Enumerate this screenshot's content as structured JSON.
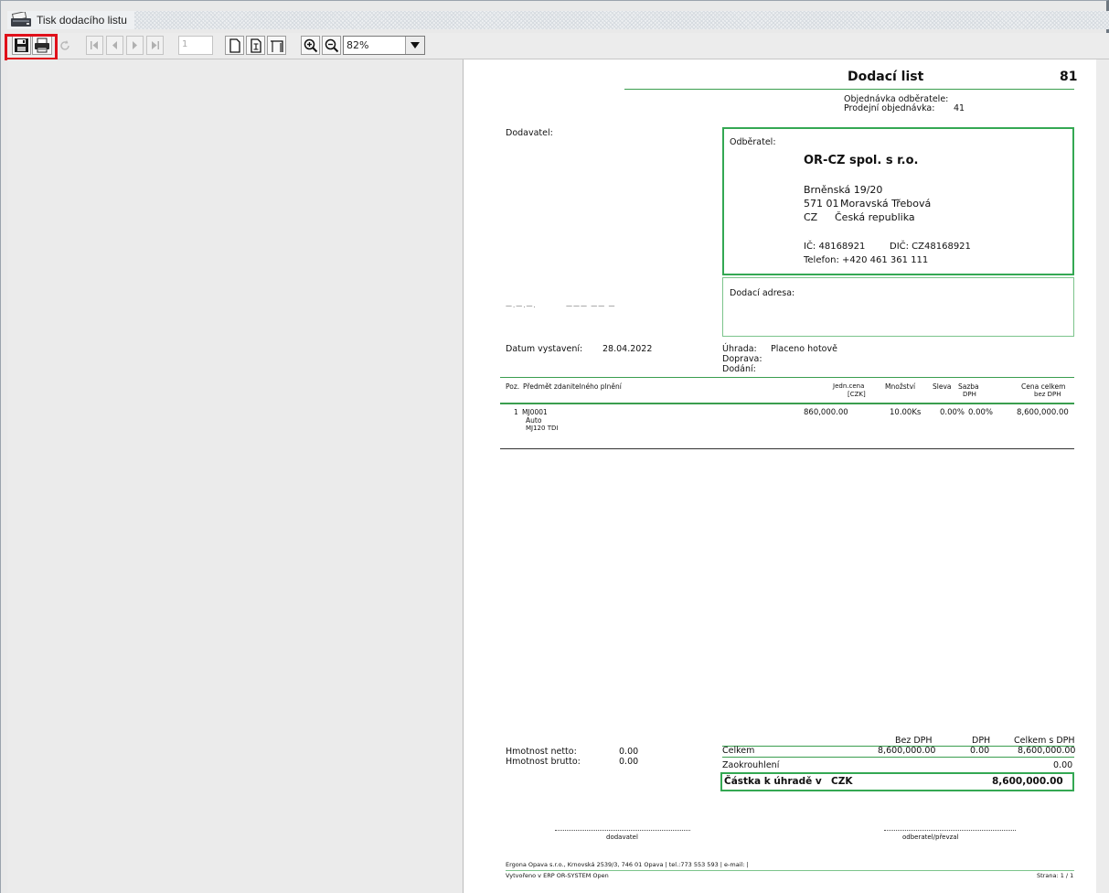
{
  "window": {
    "title": "Tisk dodacího listu"
  },
  "toolbar": {
    "page_number": "1",
    "zoom": "82%",
    "icons": [
      "save-icon",
      "print-icon",
      "reload-icon",
      "first-page-icon",
      "prev-page-icon",
      "next-page-icon",
      "last-page-icon",
      "actual-size-icon",
      "fit-page-icon",
      "fit-width-icon",
      "zoom-in-icon",
      "zoom-out-icon"
    ]
  },
  "document": {
    "title": "Dodací list",
    "number": "81",
    "order_customer_label": "Objednávka odběratele:",
    "order_sales_label": "Prodejní objednávka:",
    "order_sales_value": "41",
    "supplier_label": "Dodavatel:",
    "supplier_cutoff_1": "—.—.—.",
    "supplier_cutoff_2": "——— —— —",
    "customer_label": "Odběratel:",
    "customer": {
      "name": "OR-CZ spol. s r.o.",
      "street": "Brněnská 19/20",
      "zip": "571 01",
      "city": "Moravská Třebová",
      "country_code": "CZ",
      "country": "Česká republika",
      "ic": "IČ: 48168921",
      "dic": "DIČ: CZ48168921",
      "phone": "Telefon: +420 461 361 111"
    },
    "delivery_address_label": "Dodací adresa:",
    "issue_date_label": "Datum vystavení:",
    "issue_date": "28.04.2022",
    "payment_label": "Úhrada:",
    "payment_value": "Placeno hotově",
    "transport_label": "Doprava:",
    "delivery_label": "Dodání:",
    "table": {
      "col_pos": "Poz.",
      "col_subject": "Předmět zdanitelného plnění",
      "col_unit_price_1": "Jedn.cena",
      "col_unit_price_2": "[CZK]",
      "col_qty": "Množství",
      "col_discount": "Sleva",
      "col_vat_rate_1": "Sazba",
      "col_vat_rate_2": "DPH",
      "col_total_1": "Cena celkem",
      "col_total_2": "bez DPH",
      "rows": [
        {
          "pos": "1",
          "code": "MJ0001",
          "name": "Auto",
          "desc": "MJ120 TDI",
          "unit_price": "860,000.00",
          "qty": "10.00Ks",
          "discount": "0.00%",
          "vat": "0.00%",
          "total": "8,600,000.00"
        }
      ]
    },
    "weights": {
      "netto_label": "Hmotnost netto:",
      "netto": "0.00",
      "brutto_label": "Hmotnost brutto:",
      "brutto": "0.00"
    },
    "totals": {
      "h_bez_dph": "Bez DPH",
      "h_dph": "DPH",
      "h_celkem": "Celkem s DPH",
      "celkem_label": "Celkem",
      "celkem_bez": "8,600,000.00",
      "celkem_dph": "0.00",
      "celkem_s": "8,600,000.00",
      "rounding_label": "Zaokrouhlení",
      "rounding": "0.00",
      "pay_label": "Částka k úhradě v",
      "pay_currency": "CZK",
      "pay_value": "8,600,000.00"
    },
    "signature_supplier": "dodavatel",
    "signature_customer": "odberatel/převzal",
    "footer_company": "Ergona Opava s.r.o., Krnovská 2539/3, 746 01 Opava | tel.:773 553 593 | e-mail: |",
    "footer_created": "Vytvořeno v ERP OR-SYSTEM Open",
    "footer_page": "Strana: 1 / 1"
  }
}
